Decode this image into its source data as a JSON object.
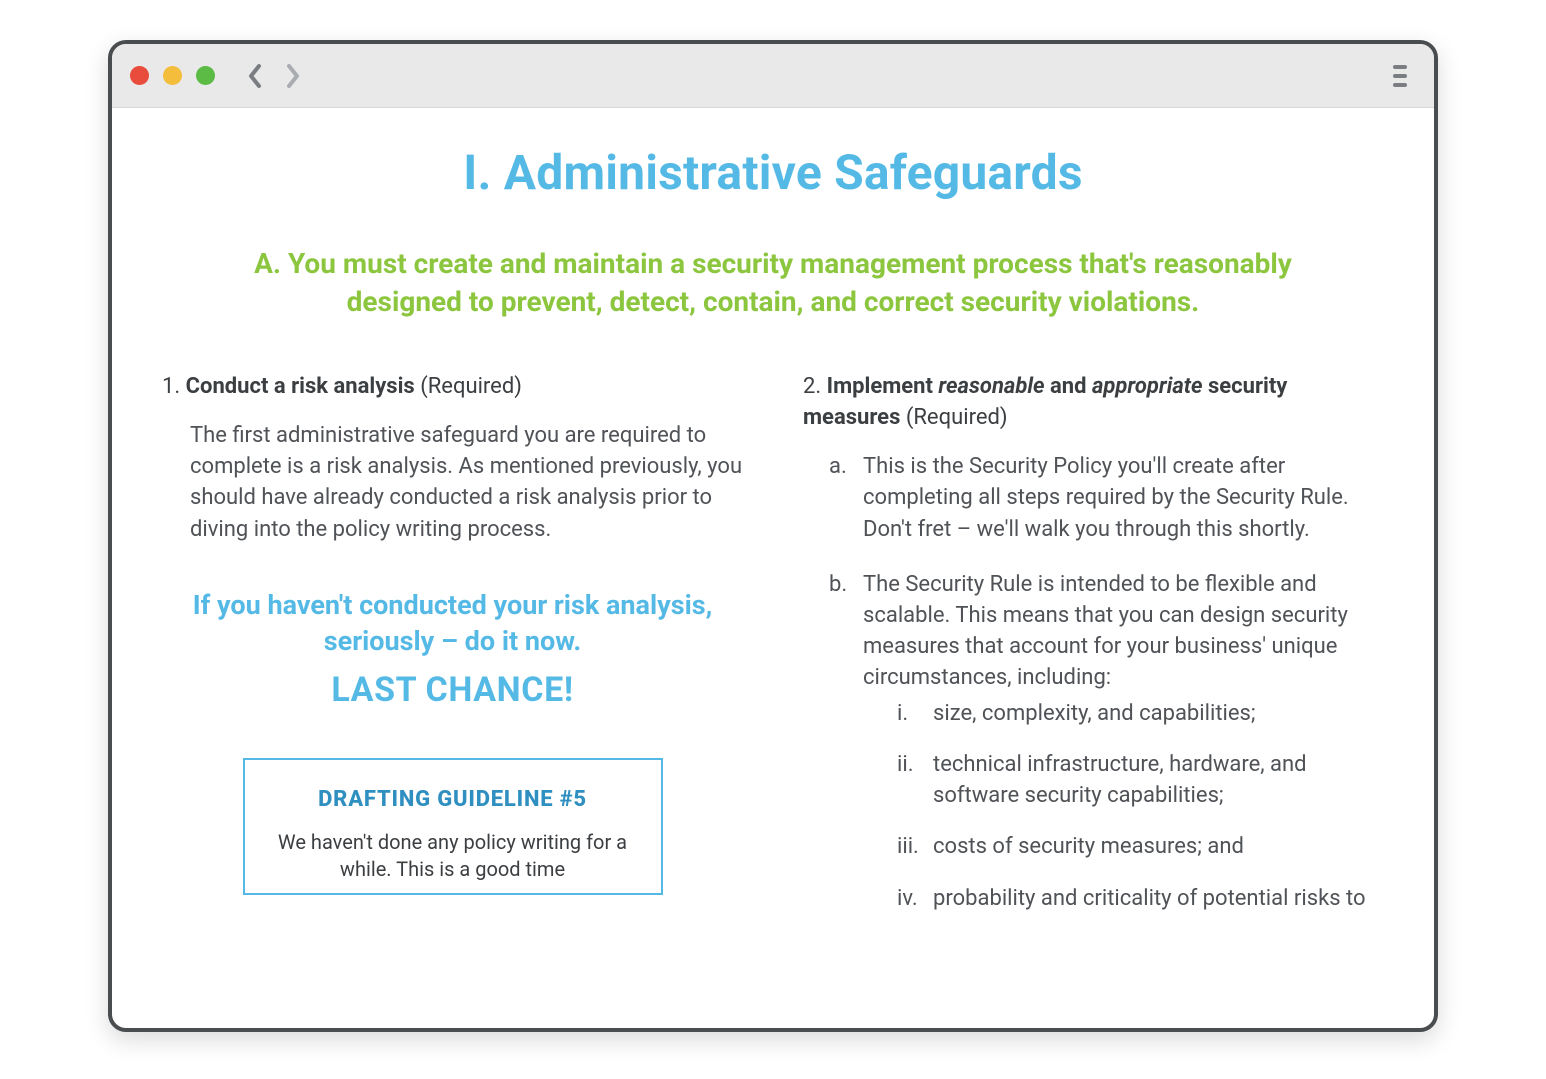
{
  "page": {
    "title": "I. Administrative Safeguards",
    "section_a": "A. You must create and maintain a security management process that's reasonably designed to prevent, detect, contain, and correct security violations."
  },
  "left": {
    "heading_num": "1.",
    "heading_bold": "Conduct a risk analysis",
    "heading_req": "(Required)",
    "body": "The first administrative safeguard you are required to complete is a risk analysis. As mentioned previously, you should have already conducted a risk analysis prior to diving into the policy writing process.",
    "callout_line1": "If you haven't conducted your risk analysis, seriously – do it now.",
    "callout_line2": "LAST CHANCE!",
    "guideline": {
      "title": "DRAFTING GUIDELINE #5",
      "body": "We haven't done any policy writing for a while.  This is a good time"
    }
  },
  "right": {
    "heading_num": "2.",
    "heading_bold_1": "Implement",
    "heading_ital_1": "reasonable",
    "heading_mid": "and",
    "heading_ital_2": "appropriate",
    "heading_bold_2": "security measures",
    "heading_req": "(Required)",
    "a_marker": "a.",
    "a_text": "This is the Security Policy you'll create after completing all steps required by the Security Rule. Don't fret – we'll walk you through this shortly.",
    "b_marker": "b.",
    "b_text": "The Security Rule is intended to be flexible and scalable. This means that you can design security measures that account for your business' unique circumstances, including:",
    "roman": {
      "i_marker": "i.",
      "i_text": "size, complexity, and capabilities;",
      "ii_marker": "ii.",
      "ii_text": "technical infrastructure, hardware, and software security capabilities;",
      "iii_marker": "iii.",
      "iii_text": "costs of security measures; and",
      "iv_marker": "iv.",
      "iv_text": "probability and criticality of potential  risks to"
    }
  }
}
